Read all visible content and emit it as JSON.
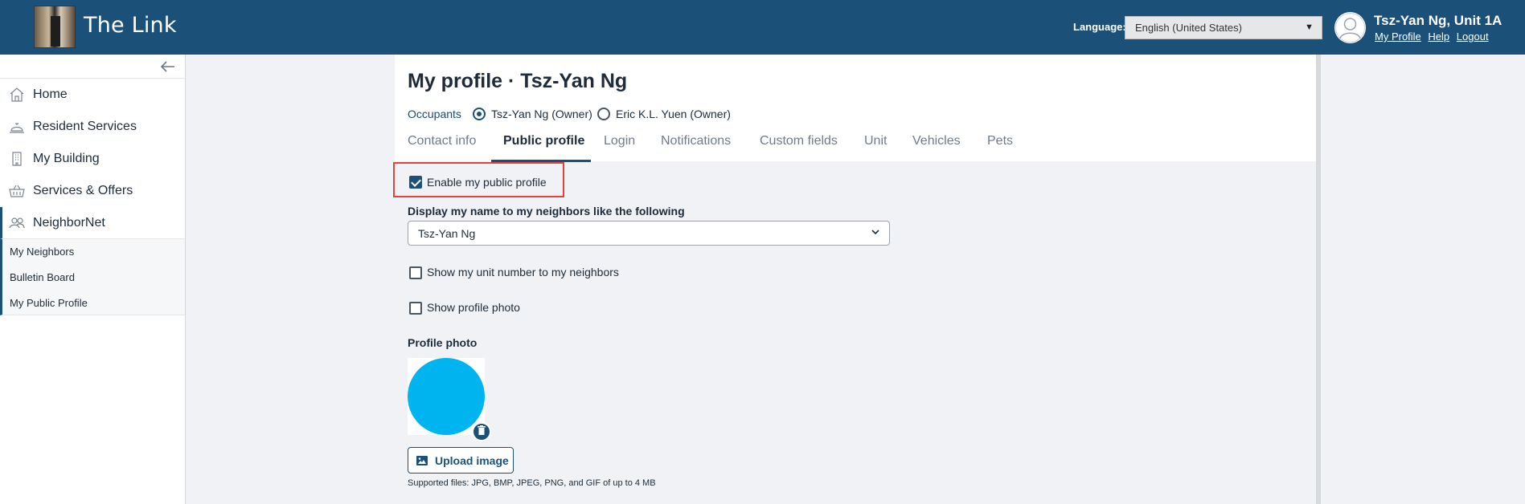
{
  "header": {
    "brand": "The Link",
    "language_label": "Language:",
    "language_value": "English (United States)",
    "user_name": "Tsz-Yan Ng, Unit 1A",
    "links": [
      "My Profile",
      "Help",
      "Logout"
    ]
  },
  "sidebar": {
    "items": [
      {
        "label": "Home",
        "icon": "home-icon"
      },
      {
        "label": "Resident Services",
        "icon": "bell-service-icon"
      },
      {
        "label": "My Building",
        "icon": "building-icon"
      },
      {
        "label": "Services & Offers",
        "icon": "basket-icon"
      },
      {
        "label": "NeighborNet",
        "icon": "people-icon"
      }
    ],
    "subitems": [
      "My Neighbors",
      "Bulletin Board",
      "My Public Profile"
    ]
  },
  "page": {
    "title": "My profile · Tsz-Yan Ng",
    "occupants_label": "Occupants",
    "occupants": [
      {
        "label": "Tsz-Yan Ng (Owner)",
        "selected": true
      },
      {
        "label": "Eric K.L. Yuen (Owner)",
        "selected": false
      }
    ],
    "tabs": [
      "Contact info",
      "Public profile",
      "Login",
      "Notifications",
      "Custom fields",
      "Unit",
      "Vehicles",
      "Pets"
    ],
    "active_tab": "Public profile"
  },
  "form": {
    "enable_public_profile": {
      "label": "Enable my public profile",
      "checked": true
    },
    "display_name_label": "Display my name to my neighbors like the following",
    "display_name_value": "Tsz-Yan Ng",
    "show_unit": {
      "label": "Show my unit number to my neighbors",
      "checked": false
    },
    "show_photo": {
      "label": "Show profile photo",
      "checked": false
    },
    "profile_photo_label": "Profile photo",
    "upload_label": "Upload image",
    "supported_files": "Supported files: JPG, BMP, JPEG, PNG, and GIF of up to 4 MB"
  },
  "colors": {
    "header_bg": "#1b5178",
    "photo_circle": "#00b4f0",
    "highlight": "#e0443a"
  }
}
